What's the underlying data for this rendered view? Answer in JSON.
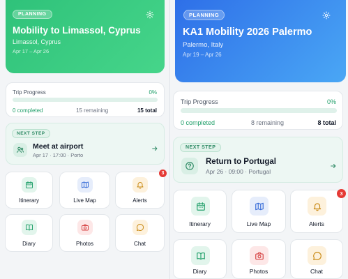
{
  "left": {
    "hero": {
      "badge": "PLANNING",
      "title": "Mobility to Limassol, Cyprus",
      "location": "Limassol, Cyprus",
      "dates": "Apr 17 – Apr 26"
    },
    "progress": {
      "label": "Trip Progress",
      "percent_text": "0%",
      "fraction": 0,
      "completed": "0 completed",
      "remaining": "15 remaining",
      "total": "15 total"
    },
    "next_step": {
      "badge": "NEXT STEP",
      "icon": "users-icon",
      "title": "Meet at airport",
      "subtitle": "Apr 17 · 17:00 · Porto"
    },
    "tiles": [
      {
        "label": "Itinerary",
        "icon": "calendar-icon"
      },
      {
        "label": "Live Map",
        "icon": "map-icon"
      },
      {
        "label": "Alerts",
        "icon": "bell-icon",
        "count": "3"
      },
      {
        "label": "Diary",
        "icon": "book-icon"
      },
      {
        "label": "Photos",
        "icon": "camera-icon"
      },
      {
        "label": "Chat",
        "icon": "chat-icon"
      }
    ]
  },
  "right": {
    "hero": {
      "badge": "PLANNING",
      "title": "KA1 Mobility 2026 Palermo",
      "location": "Palermo, Italy",
      "dates": "Apr 19 – Apr 26"
    },
    "progress": {
      "label": "Trip Progress",
      "percent_text": "0%",
      "fraction": 0,
      "completed": "0 completed",
      "remaining": "8 remaining",
      "total": "8 total"
    },
    "next_step": {
      "badge": "NEXT STEP",
      "icon": "help-circle-icon",
      "title": "Return to Portugal",
      "subtitle": "Apr 26 · 09:00 · Portugal"
    },
    "tiles": [
      {
        "label": "Itinerary",
        "icon": "calendar-icon"
      },
      {
        "label": "Live Map",
        "icon": "map-icon"
      },
      {
        "label": "Alerts",
        "icon": "bell-icon",
        "count": "3"
      },
      {
        "label": "Diary",
        "icon": "book-icon"
      },
      {
        "label": "Photos",
        "icon": "camera-icon"
      },
      {
        "label": "Chat",
        "icon": "chat-icon"
      }
    ]
  },
  "colors": {
    "left_hero": "#2fc27a",
    "right_hero": "#2e6fe8",
    "accent_green": "#22a06b",
    "alert_red": "#e53935"
  }
}
